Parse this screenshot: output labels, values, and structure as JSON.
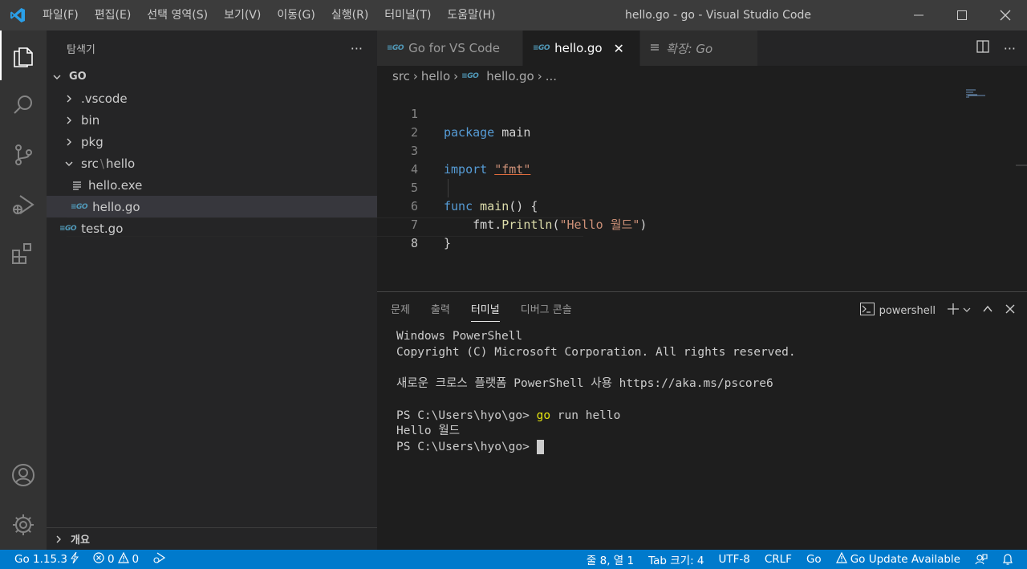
{
  "titlebar": {
    "menus": [
      "파일(F)",
      "편집(E)",
      "선택 영역(S)",
      "보기(V)",
      "이동(G)",
      "실행(R)",
      "터미널(T)",
      "도움말(H)"
    ],
    "title": "hello.go - go - Visual Studio Code"
  },
  "sidebar": {
    "title": "탐색기",
    "root": "GO",
    "items": [
      ".vscode",
      "bin",
      "pkg",
      "src",
      "\\",
      "hello",
      "hello.exe",
      "hello.go",
      "test.go"
    ],
    "footer": "개요"
  },
  "tabs": [
    {
      "label": "Go for VS Code"
    },
    {
      "label": "hello.go"
    },
    {
      "label": "확장: Go"
    }
  ],
  "breadcrumb": [
    "src",
    "hello",
    "hello.go",
    "..."
  ],
  "editor": {
    "line_numbers": [
      "1",
      "2",
      "3",
      "4",
      "5",
      "6",
      "7",
      "8"
    ],
    "lines": {
      "l1_kw": "package",
      "l1_id": "main",
      "l3_kw": "import",
      "l3_str": "\"fmt\"",
      "l5_kw": "func",
      "l5_fn": "main",
      "l5_rest": "() {",
      "l6_pkg": "fmt",
      "l6_dot": ".",
      "l6_fn": "Println",
      "l6_open": "(",
      "l6_str": "\"Hello 월드\"",
      "l6_close": ")",
      "l7": "}"
    }
  },
  "panel": {
    "tabs": [
      "문제",
      "출력",
      "터미널",
      "디버그 콘솔"
    ],
    "shell": "powershell",
    "terminal": {
      "l1": "Windows PowerShell",
      "l2": "Copyright (C) Microsoft Corporation. All rights reserved.",
      "l3": "새로운 크로스 플랫폼 PowerShell 사용 https://aka.ms/pscore6",
      "l4_prompt": "PS C:\\Users\\hyo\\go> ",
      "l4_cmd": "go",
      "l4_rest": " run hello",
      "l5": "Hello 월드",
      "l6_prompt": "PS C:\\Users\\hyo\\go> "
    }
  },
  "statusbar": {
    "go_version": "Go 1.15.3",
    "errors": "0",
    "warnings": "0",
    "position": "줄 8, 열 1",
    "tab_size": "Tab 크기: 4",
    "encoding": "UTF-8",
    "eol": "CRLF",
    "language": "Go",
    "update": "Go Update Available"
  },
  "colors": {
    "accent": "#007acc",
    "activity_bar": "#333333",
    "sidebar": "#252526",
    "editor": "#1e1e1e"
  }
}
